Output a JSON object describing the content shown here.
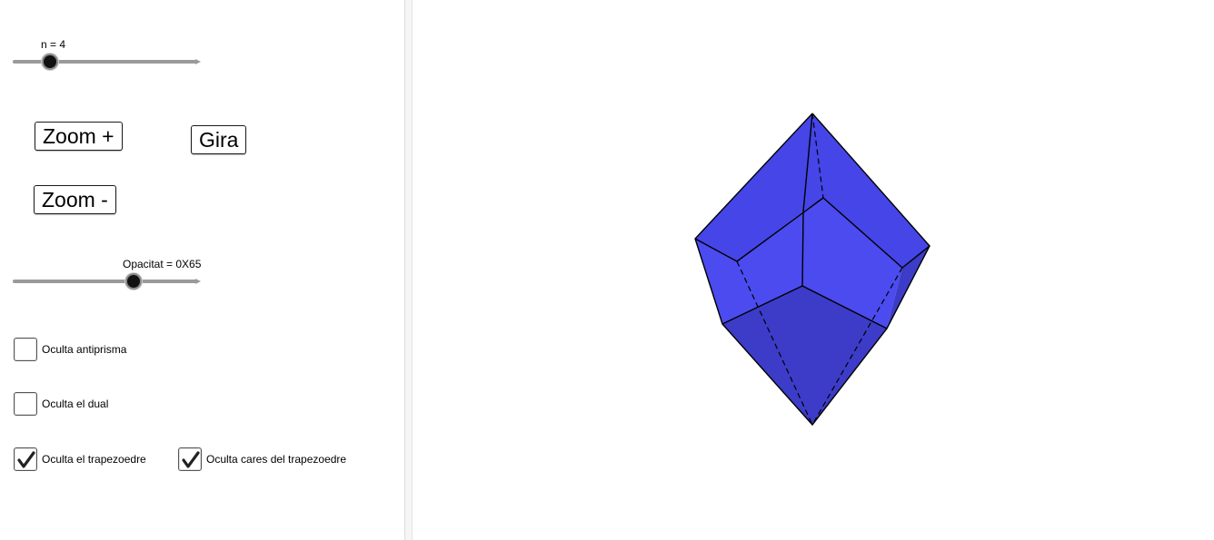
{
  "sliders": {
    "n": {
      "label": "n = 4",
      "fraction": 0.2
    },
    "opacity": {
      "label": "Opacitat = 0X65",
      "fraction": 0.65
    }
  },
  "buttons": {
    "zoom_in": "Zoom +",
    "rotate": "Gira",
    "zoom_out": "Zoom -"
  },
  "checkboxes": {
    "hide_antiprism": {
      "label": "Oculta antiprisma",
      "checked": false
    },
    "hide_dual": {
      "label": "Oculta el dual",
      "checked": false
    },
    "hide_trapezohedron": {
      "label": "Oculta el trapezoedre",
      "checked": true
    },
    "hide_trapezohedron_faces": {
      "label": "Oculta cares del trapezoedre",
      "checked": true
    }
  },
  "colors": {
    "polyhedron_face": "#4545e8",
    "polyhedron_face_dark": "#3c3cc8",
    "polyhedron_face_light": "#4b4bf0",
    "edge": "#000000",
    "divider": "#f5f5f5"
  }
}
